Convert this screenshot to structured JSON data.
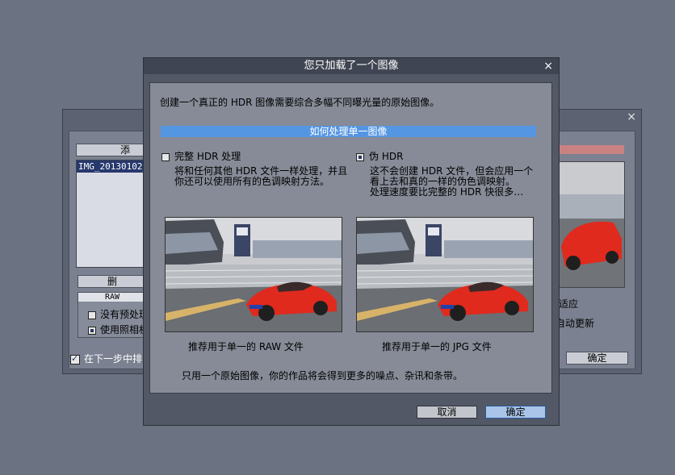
{
  "background_window": {
    "close_glyph": "×",
    "add_button": "添",
    "file_item": "IMG_20130102_0",
    "delete_button": "删",
    "raw_header": "RAW",
    "opt_no_preview": "没有预处理",
    "opt_use_camera": "使用照相机",
    "next_step_check": "在下一步中排",
    "fit_label": "适应",
    "auto_update_label": "自动更新",
    "ok_button": "确定"
  },
  "dialog": {
    "title": "您只加载了一个图像",
    "close_glyph": "×",
    "intro": "创建一个真正的 HDR 图像需要综合多幅不同曝光量的原始图像。",
    "section_title": "如何处理单一图像",
    "option_full": {
      "title": "完整 HDR 处理",
      "desc1": "将和任何其他 HDR 文件一样处理，并且",
      "desc2": "你还可以使用所有的色调映射方法。",
      "caption": "推荐用于单一的 RAW 文件"
    },
    "option_pseudo": {
      "title": "伪 HDR",
      "desc1": "这不会创建 HDR 文件，但会应用一个",
      "desc2": "看上去和真的一样的伪色调映射。",
      "desc3": "处理速度要比完整的 HDR 快很多…",
      "caption": "推荐用于单一的 JPG 文件"
    },
    "warning": "只用一个原始图像，你的作品将会得到更多的噪点、杂讯和条带。",
    "cancel_button": "取消",
    "ok_button": "确定"
  },
  "colors": {
    "accent": "#5596e3",
    "car": "#e02a1e"
  }
}
